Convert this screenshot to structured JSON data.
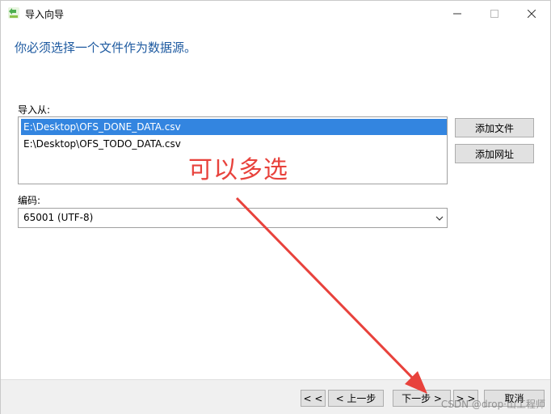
{
  "window": {
    "title": "导入向导",
    "minimize_label": "—",
    "maximize_label": "☐",
    "close_label": "✕"
  },
  "heading": "你必须选择一个文件作为数据源。",
  "import_from": {
    "label": "导入从:",
    "files": [
      {
        "path": "E:\\Desktop\\OFS_DONE_DATA.csv",
        "selected": true
      },
      {
        "path": "E:\\Desktop\\OFS_TODO_DATA.csv",
        "selected": false
      }
    ],
    "add_file_label": "添加文件",
    "add_url_label": "添加网址"
  },
  "encoding": {
    "label": "编码:",
    "selected": "65001 (UTF-8)"
  },
  "nav": {
    "first_label": "< <",
    "prev_label": "< 上一步",
    "next_label": "下一步 >",
    "last_label": "> >",
    "cancel_label": "取消"
  },
  "annotation": {
    "text": "可以多选",
    "color": "#e8423c"
  },
  "watermark": "CSDN @drop·山工程师",
  "colors": {
    "heading": "#1e5aa0",
    "selection": "#3385e0"
  }
}
